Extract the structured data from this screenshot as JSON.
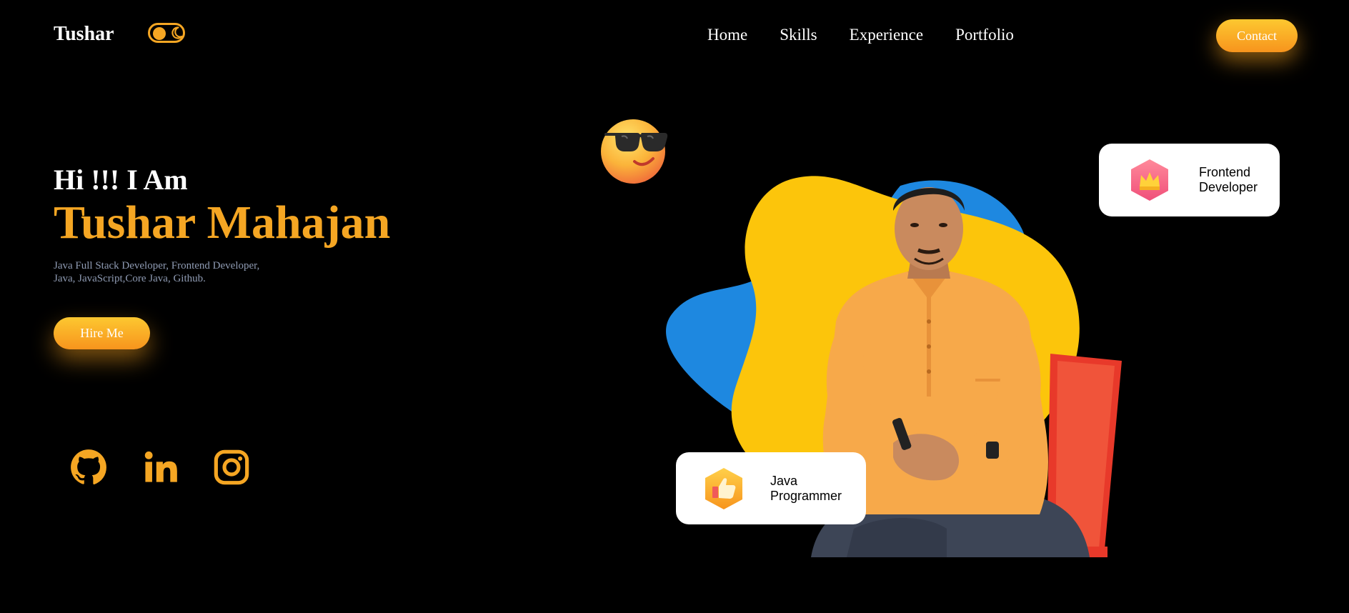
{
  "brand": "Tushar",
  "nav": {
    "items": [
      "Home",
      "Skills",
      "Experience",
      "Portfolio"
    ],
    "contact_label": "Contact"
  },
  "intro": {
    "greeting": "Hi !!! I Am",
    "name": "Tushar Mahajan",
    "description_line1": "Java Full Stack Developer, Frontend Developer,",
    "description_line2": "Java, JavaScript,Core Java, Github.",
    "hire_label": "Hire Me"
  },
  "socials": [
    "github-icon",
    "linkedin-icon",
    "instagram-icon"
  ],
  "cards": {
    "frontend": {
      "line1": "Frontend",
      "line2": "Developer",
      "icon": "crown-icon"
    },
    "java": {
      "line1": "Java",
      "line2": "Programmer",
      "icon": "thumbs-up-icon"
    }
  },
  "colors": {
    "accent": "#f5a623",
    "background": "#000000",
    "blob_yellow": "#fcc50b",
    "blob_blue": "#1e88e0",
    "description": "#8f9bb3"
  }
}
